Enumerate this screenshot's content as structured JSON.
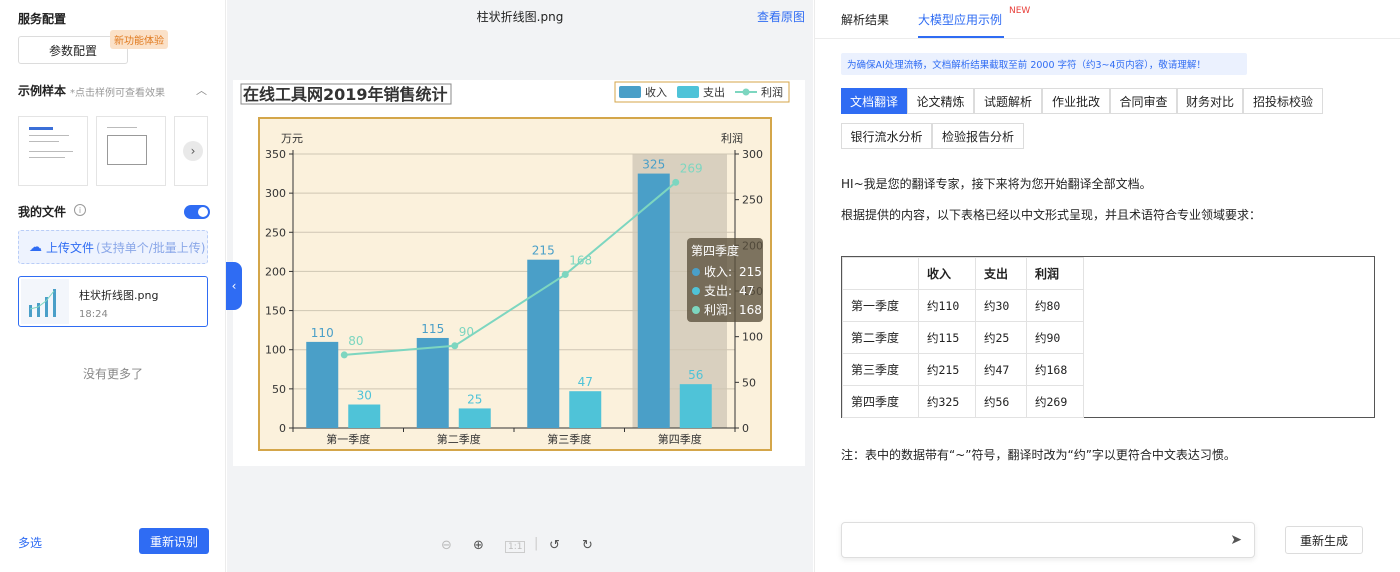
{
  "left": {
    "service_config_title": "服务配置",
    "param_config_button": "参数配置",
    "new_feature_badge": "新功能体验",
    "samples_title": "示例样本",
    "samples_hint": "*点击样例可查看效果",
    "my_files_title": "我的文件",
    "info_icon": "i",
    "upload_label": "上传文件",
    "upload_hint": "(支持单个/批量上传)",
    "file": {
      "name": "柱状折线图.png",
      "time": "18:24"
    },
    "no_more": "没有更多了",
    "multi_select": "多选",
    "reidentify_button": "重新识别"
  },
  "middle": {
    "file_title": "柱状折线图.png",
    "view_original": "查看原图"
  },
  "chart_data": {
    "type": "bar",
    "title": "在线工具网2019年销售统计",
    "categories": [
      "第一季度",
      "第二季度",
      "第三季度",
      "第四季度"
    ],
    "series": [
      {
        "name": "收入",
        "kind": "bar",
        "axis": "left",
        "values": [
          110,
          115,
          215,
          325
        ],
        "color": "#4a9fc8"
      },
      {
        "name": "支出",
        "kind": "bar",
        "axis": "left",
        "values": [
          30,
          25,
          47,
          56
        ],
        "color": "#4fc3d8"
      },
      {
        "name": "利润",
        "kind": "line",
        "axis": "right",
        "values": [
          80,
          90,
          168,
          269
        ],
        "color": "#7dd6c0"
      }
    ],
    "ylabel_left": "万元",
    "ylabel_right": "利润",
    "ylim_left": [
      0,
      350
    ],
    "ylim_right": [
      0,
      300
    ],
    "yticks_left": [
      0,
      50,
      100,
      150,
      200,
      250,
      300,
      350
    ],
    "yticks_right": [
      0,
      50,
      100,
      150,
      200,
      250,
      300
    ],
    "legend_position": "top-right",
    "grid": true,
    "tooltip": {
      "category": "第四季度",
      "rows": [
        {
          "label": "收入",
          "value": 215
        },
        {
          "label": "支出",
          "value": 47
        },
        {
          "label": "利润",
          "value": 168
        }
      ]
    }
  },
  "right": {
    "tabs": [
      "解析结果",
      "大模型应用示例"
    ],
    "new_badge": "NEW",
    "notice": "为确保AI处理流畅，文档解析结果截取至前 2000 字符（约3~4页内容），敬请理解！",
    "functions": [
      "文档翻译",
      "论文精炼",
      "试题解析",
      "作业批改",
      "合同审查",
      "财务对比",
      "招投标校验",
      "银行流水分析",
      "检验报告分析"
    ],
    "intro": "HI~我是您的翻译专家，接下来将为您开始翻译全部文档。",
    "lead": "根据提供的内容，以下表格已经以中文形式呈现，并且术语符合专业领域要求：",
    "table": {
      "headers": [
        "",
        "收入",
        "支出",
        "利润"
      ],
      "rows": [
        [
          "第一季度",
          "约110",
          "约30",
          "约80"
        ],
        [
          "第二季度",
          "约115",
          "约25",
          "约90"
        ],
        [
          "第三季度",
          "约215",
          "约47",
          "约168"
        ],
        [
          "第四季度",
          "约325",
          "约56",
          "约269"
        ]
      ]
    },
    "note": "注：表中的数据带有“~”符号，翻译时改为“约”字以更符合中文表达习惯。",
    "regenerate_button": "重新生成"
  }
}
